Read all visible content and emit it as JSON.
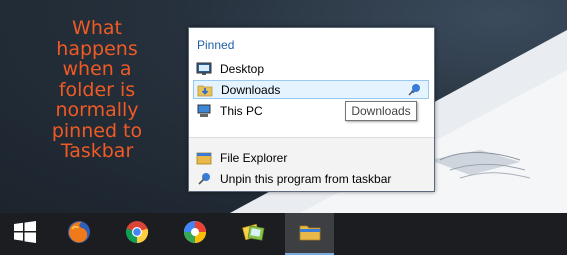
{
  "caption": {
    "lines": [
      "What",
      "happens",
      "when a",
      "folder is",
      "normally",
      "pinned to",
      "Taskbar"
    ]
  },
  "jump_list": {
    "header": "Pinned",
    "pinned_items": [
      {
        "label": "Desktop",
        "icon": "desktop-icon"
      },
      {
        "label": "Downloads",
        "icon": "downloads-folder-icon"
      },
      {
        "label": "This PC",
        "icon": "this-pc-icon"
      }
    ],
    "tasks": [
      {
        "label": "File Explorer",
        "icon": "file-explorer-icon"
      },
      {
        "label": "Unpin this program from taskbar",
        "icon": "unpin-icon"
      }
    ]
  },
  "tooltip": "Downloads",
  "taskbar": {
    "buttons": [
      {
        "icon": "windows-start-icon"
      },
      {
        "icon": "firefox-icon"
      },
      {
        "icon": "chrome-icon"
      },
      {
        "icon": "picasa-icon"
      },
      {
        "icon": "live-gallery-icon"
      },
      {
        "icon": "file-explorer-icon"
      }
    ]
  },
  "colors": {
    "caption": "#f05a24",
    "header": "#1f5fa8",
    "highlight": "#e5f3ff",
    "taskbar": "#1b1d21"
  }
}
